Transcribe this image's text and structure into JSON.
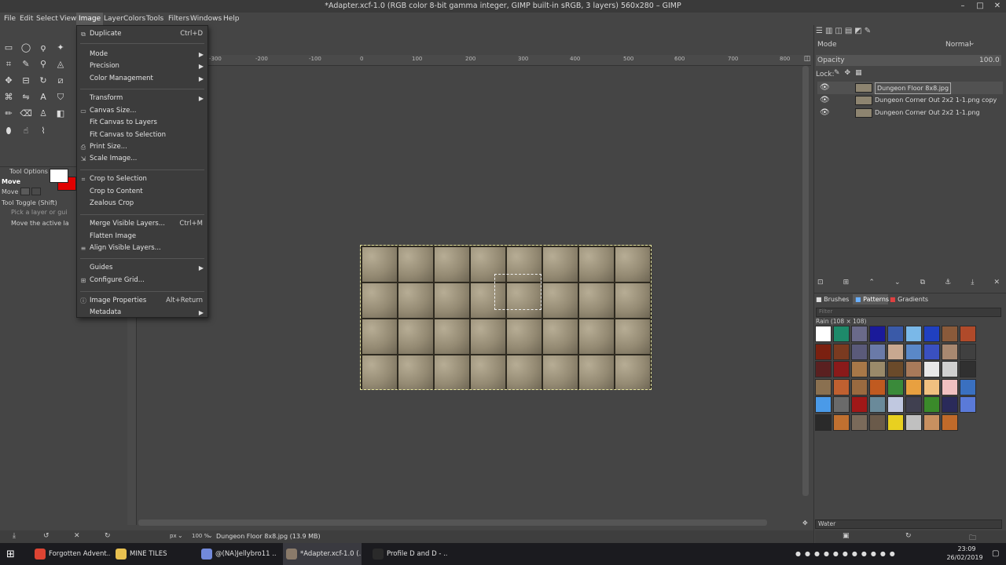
{
  "window": {
    "title": "*Adapter.xcf-1.0 (RGB color 8-bit gamma integer, GIMP built-in sRGB, 3 layers) 560x280 – GIMP",
    "minimize": "–",
    "maximize": "□",
    "close": "✕"
  },
  "menubar": [
    "File",
    "Edit",
    "Select",
    "View",
    "Image",
    "Layer",
    "Colors",
    "Tools",
    "Filters",
    "Windows",
    "Help"
  ],
  "image_menu": {
    "items": [
      {
        "label": "Duplicate",
        "shortcut": "Ctrl+D",
        "icon": "⧉"
      },
      {
        "label": "Mode",
        "submenu": "▶"
      },
      {
        "label": "Precision",
        "submenu": "▶"
      },
      {
        "label": "Color Management",
        "submenu": "▶"
      },
      {
        "label": "Transform",
        "submenu": "▶"
      },
      {
        "label": "Canvas Size...",
        "icon": "▭"
      },
      {
        "label": "Fit Canvas to Layers"
      },
      {
        "label": "Fit Canvas to Selection"
      },
      {
        "label": "Print Size...",
        "icon": "⎙"
      },
      {
        "label": "Scale Image...",
        "icon": "⇲"
      },
      {
        "label": "Crop to Selection",
        "icon": "⌗"
      },
      {
        "label": "Crop to Content"
      },
      {
        "label": "Zealous Crop"
      },
      {
        "label": "Merge Visible Layers...",
        "shortcut": "Ctrl+M"
      },
      {
        "label": "Flatten Image"
      },
      {
        "label": "Align Visible Layers...",
        "icon": "≡"
      },
      {
        "label": "Guides",
        "submenu": "▶"
      },
      {
        "label": "Configure Grid...",
        "icon": "⊞"
      },
      {
        "label": "Image Properties",
        "shortcut": "Alt+Return",
        "icon": "ⓘ"
      },
      {
        "label": "Metadata",
        "submenu": "▶"
      }
    ]
  },
  "tool_options": {
    "title": "Tool Options",
    "tool": "Move",
    "toggle": "Tool Toggle  (Shift)",
    "option1": "Pick a layer or gui",
    "option2": "Move the active la"
  },
  "ruler_labels": [
    "-300",
    "-200",
    "-100",
    "0",
    "100",
    "200",
    "300",
    "400",
    "500",
    "600",
    "700",
    "800"
  ],
  "status": {
    "unit": "px",
    "zoom": "100 %",
    "message": "Dungeon Floor 8x8.jpg (13.9 MB)"
  },
  "layers_panel": {
    "mode_label": "Mode",
    "mode_value": "Normal",
    "opacity_label": "Opacity",
    "opacity_value": "100.0",
    "lock_label": "Lock:",
    "layers": [
      {
        "name": "Dungeon Floor 8x8.jpg"
      },
      {
        "name": "Dungeon Corner Out 2x2 1-1.png copy"
      },
      {
        "name": "Dungeon Corner Out 2x2 1-1.png"
      }
    ]
  },
  "brushes_panel": {
    "tabs": [
      "Brushes",
      "Patterns",
      "Gradients"
    ],
    "filter_placeholder": "Filter",
    "pattern_name": "Rain (108 × 108)",
    "tag_value": "Water",
    "pattern_colors": [
      "#ffffff",
      "#1e8a6a",
      "#6a6a8a",
      "#1a1a9a",
      "#3a5aa8",
      "#7ab8e8",
      "#2040c0",
      "#8a5a3a",
      "#b04a2a",
      "#7a2010",
      "#7a3a20",
      "#5a5a7a",
      "#6a7aa8",
      "#c8a890",
      "#5a88c8",
      "#3a50c0",
      "#a88870",
      "#404040",
      "#5a2020",
      "#8a1a1a",
      "#a87848",
      "#9a8a6a",
      "#6a4a2a",
      "#a87a5a",
      "#e8e8e8",
      "#d0d0d0",
      "#303030",
      "#8a7050",
      "#c06030",
      "#9a6a40",
      "#c05a20",
      "#3a8a3a",
      "#e8a040",
      "#f0c080",
      "#f0c0c0",
      "#3a70c0",
      "#4a9ae8",
      "#6a6a6a",
      "#a01818",
      "#6a8a9a",
      "#c0c8e0",
      "#404050",
      "#3a8a2a",
      "#2a2a5a",
      "#5a7ad8",
      "#2a2a2a",
      "#c07030",
      "#7a6a5a",
      "#6a5a4a",
      "#e8d020",
      "#c0c0c0",
      "#c89060",
      "#c06a2a"
    ]
  },
  "taskbar": {
    "items": [
      {
        "label": "Forgotten Advent...",
        "color": "#dd4433"
      },
      {
        "label": "MINE TILES",
        "color": "#e8c050"
      },
      {
        "label": "@(NA)Jellybro11 ...",
        "color": "#7289da"
      },
      {
        "label": "*Adapter.xcf-1.0 (...",
        "color": "#8a7a6a"
      },
      {
        "label": "Profile D and D - ...",
        "color": "#2a2a2a"
      }
    ],
    "time": "23:09",
    "date": "26/02/2019"
  }
}
